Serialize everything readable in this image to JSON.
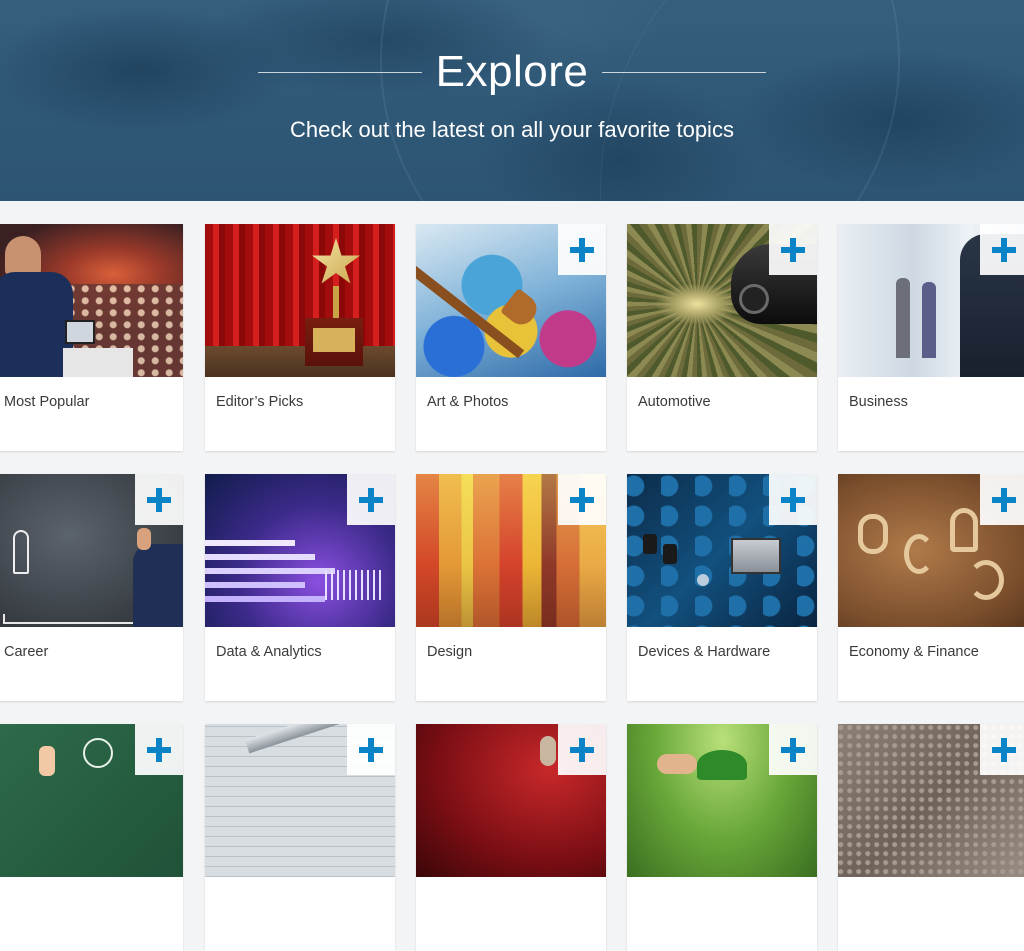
{
  "hero": {
    "title": "Explore",
    "subtitle": "Check out the latest on all your favorite topics"
  },
  "colors": {
    "hero_bg": "#2f5877",
    "accent_plus": "#0a84c6",
    "card_bg": "#ffffff",
    "page_bg": "#f3f4f5",
    "label_text": "#3a3a3a"
  },
  "topics": [
    {
      "label": "Most Popular",
      "image": "speaker-audience",
      "has_add": false
    },
    {
      "label": "Editor’s Picks",
      "image": "star-trophy-curtain",
      "has_add": false
    },
    {
      "label": "Art & Photos",
      "image": "paint-brush",
      "has_add": true
    },
    {
      "label": "Automotive",
      "image": "speeding-car",
      "has_add": true
    },
    {
      "label": "Business",
      "image": "office-people",
      "has_add": true
    },
    {
      "label": "Career",
      "image": "chalk-stairs",
      "has_add": true
    },
    {
      "label": "Data & Analytics",
      "image": "data-bars",
      "has_add": true
    },
    {
      "label": "Design",
      "image": "color-stripes",
      "has_add": true
    },
    {
      "label": "Devices & Hardware",
      "image": "circuit-board",
      "has_add": true
    },
    {
      "label": "Economy & Finance",
      "image": "currency-symbols",
      "has_add": true
    },
    {
      "label": "",
      "image": "chalkboard-idea",
      "has_add": true
    },
    {
      "label": "",
      "image": "caliper-blueprint",
      "has_add": true
    },
    {
      "label": "",
      "image": "red-microphone",
      "has_add": true
    },
    {
      "label": "",
      "image": "hands-plant",
      "has_add": true
    },
    {
      "label": "",
      "image": "stone-texture",
      "has_add": true
    }
  ],
  "icons": {
    "add": "plus-icon"
  }
}
